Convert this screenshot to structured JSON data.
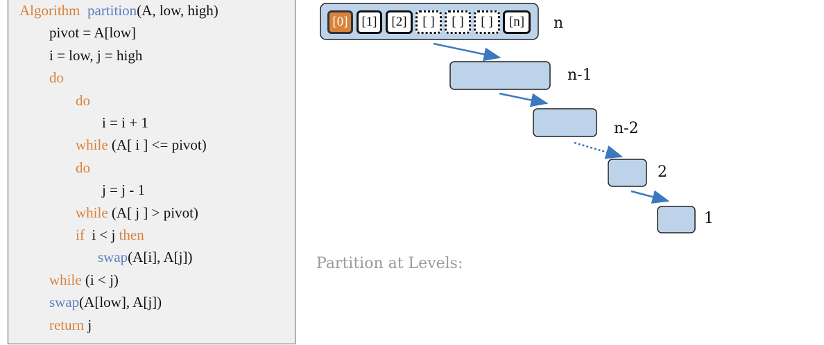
{
  "code": {
    "lines": [
      [
        {
          "t": "Algorithm  ",
          "c": "kw"
        },
        {
          "t": "partition",
          "c": "fn"
        },
        {
          "t": "(A, low, high)"
        }
      ],
      [
        {
          "t": "pivot = A[low]"
        }
      ],
      [
        {
          "t": "i = low, j = high"
        }
      ],
      [
        {
          "t": "do",
          "c": "kw"
        }
      ],
      [
        {
          "t": "do",
          "c": "kw"
        }
      ],
      [
        {
          "t": "i = i + 1"
        }
      ],
      [
        {
          "t": "while",
          "c": "kw"
        },
        {
          "t": " (A[ i ] <= pivot)"
        }
      ],
      [
        {
          "t": "do",
          "c": "kw"
        }
      ],
      [
        {
          "t": "j = j - 1"
        }
      ],
      [
        {
          "t": "while",
          "c": "kw"
        },
        {
          "t": " (A[ j ] > pivot)"
        }
      ],
      [
        {
          "t": "if",
          "c": "kw"
        },
        {
          "t": "  i < j "
        },
        {
          "t": "then",
          "c": "kw"
        }
      ],
      [
        {
          "t": "swap",
          "c": "fn"
        },
        {
          "t": "(A[i], A[j])"
        }
      ],
      [
        {
          "t": "while",
          "c": "kw"
        },
        {
          "t": " (i < j)"
        }
      ],
      [
        {
          "t": "swap",
          "c": "fn"
        },
        {
          "t": "(A[low], A[j])"
        }
      ],
      [
        {
          "t": "return",
          "c": "kw"
        },
        {
          "t": " j"
        }
      ]
    ]
  },
  "array_cells": [
    "[0]",
    "[1]",
    "[2]",
    "[ ]",
    "[ ]",
    "[ ]",
    "[n]"
  ],
  "levels": [
    {
      "label": "n"
    },
    {
      "label": "n-1"
    },
    {
      "label": "n-2"
    },
    {
      "label": "2"
    },
    {
      "label": "1"
    }
  ],
  "caption": "Partition at Levels:",
  "colors": {
    "keyword": "#d9823b",
    "function": "#5b7fbf",
    "box_fill": "#bdd3ea",
    "arrow": "#3b78bf"
  }
}
